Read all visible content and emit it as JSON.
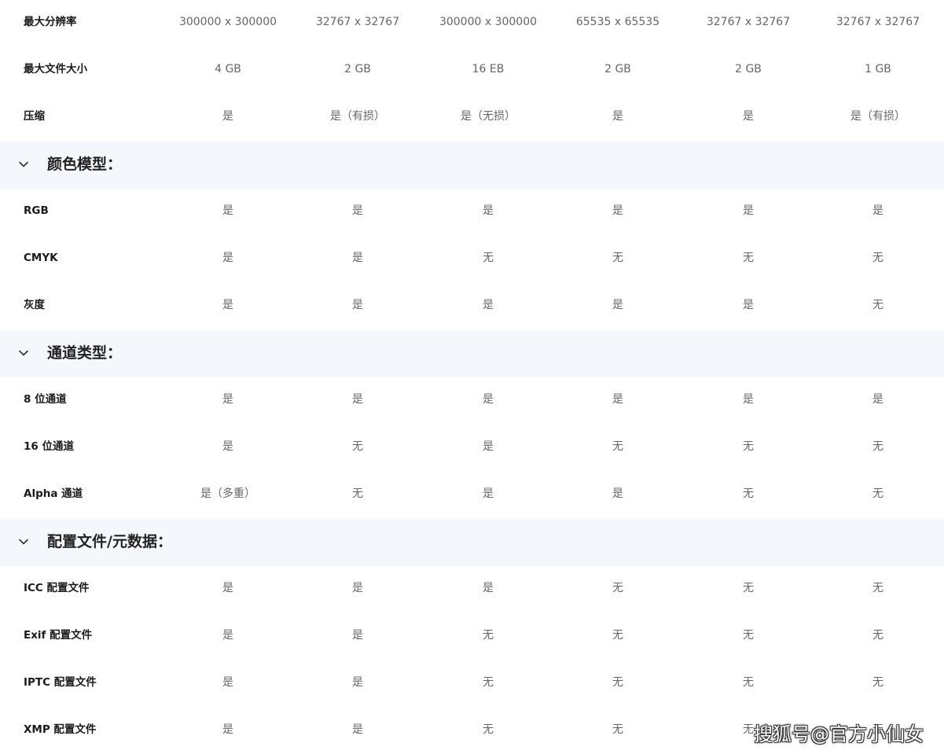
{
  "rows_top": [
    {
      "label": "最大分辨率",
      "values": [
        "300000 x 300000",
        "32767 x 32767",
        "300000 x 300000",
        "65535 x 65535",
        "32767 x 32767",
        "32767 x 32767"
      ]
    },
    {
      "label": "最大文件大小",
      "values": [
        "4 GB",
        "2 GB",
        "16 EB",
        "2 GB",
        "2 GB",
        "1 GB"
      ]
    },
    {
      "label": "压缩",
      "values": [
        "是",
        "是（有损）",
        "是（无损）",
        "是",
        "是",
        "是（有损）"
      ]
    }
  ],
  "sections": [
    {
      "title": "颜色模型：",
      "icon": "chevron-down-icon",
      "rows": [
        {
          "label": "RGB",
          "values": [
            "是",
            "是",
            "是",
            "是",
            "是",
            "是"
          ]
        },
        {
          "label": "CMYK",
          "values": [
            "是",
            "是",
            "无",
            "无",
            "无",
            "无"
          ]
        },
        {
          "label": "灰度",
          "values": [
            "是",
            "是",
            "是",
            "是",
            "是",
            "无"
          ]
        }
      ]
    },
    {
      "title": "通道类型：",
      "icon": "chevron-down-icon",
      "rows": [
        {
          "label": "8 位通道",
          "values": [
            "是",
            "是",
            "是",
            "是",
            "是",
            "是"
          ]
        },
        {
          "label": "16 位通道",
          "values": [
            "是",
            "无",
            "是",
            "无",
            "无",
            "无"
          ]
        },
        {
          "label": "Alpha 通道",
          "values": [
            "是（多重）",
            "无",
            "是",
            "是",
            "无",
            "无"
          ]
        }
      ]
    },
    {
      "title": "配置文件/元数据：",
      "icon": "chevron-down-icon",
      "rows": [
        {
          "label": "ICC 配置文件",
          "values": [
            "是",
            "是",
            "是",
            "无",
            "无",
            "无"
          ]
        },
        {
          "label": "Exif 配置文件",
          "values": [
            "是",
            "是",
            "无",
            "无",
            "无",
            "无"
          ]
        },
        {
          "label": "IPTC 配置文件",
          "values": [
            "是",
            "是",
            "无",
            "无",
            "无",
            "无"
          ]
        },
        {
          "label": "XMP 配置文件",
          "values": [
            "是",
            "是",
            "无",
            "无",
            "无",
            "无"
          ]
        }
      ]
    }
  ],
  "watermark": "搜狐号@官方小仙女",
  "colors": {
    "section_bg": "#f4f8fc",
    "label_text": "#1a1a1a",
    "value_text": "#666666"
  }
}
